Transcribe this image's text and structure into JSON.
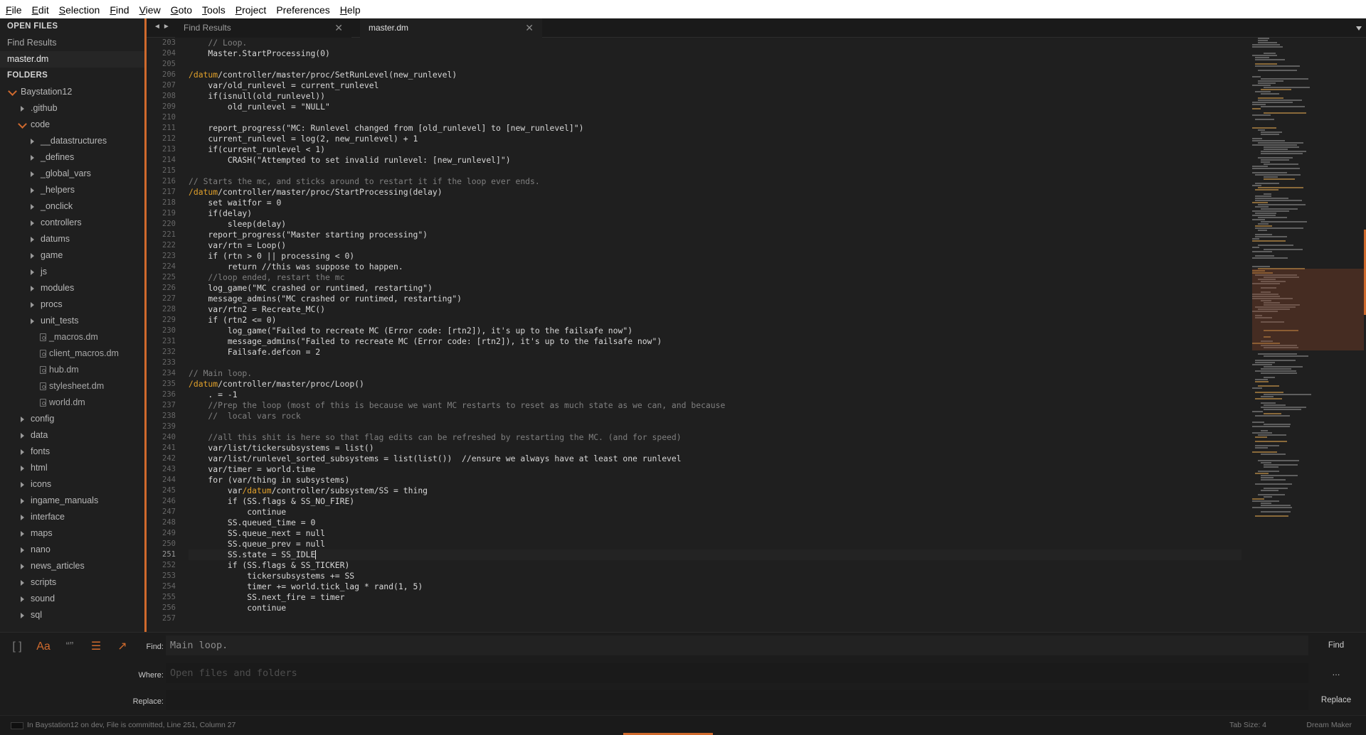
{
  "menu": [
    {
      "acc": "F",
      "rest": "ile"
    },
    {
      "acc": "E",
      "rest": "dit"
    },
    {
      "acc": "S",
      "rest": "election"
    },
    {
      "acc": "F",
      "rest": "ind"
    },
    {
      "acc": "V",
      "rest": "iew"
    },
    {
      "acc": "G",
      "rest": "oto"
    },
    {
      "acc": "T",
      "rest": "ools"
    },
    {
      "acc": "P",
      "rest": "roject"
    },
    {
      "acc": "",
      "rest": "Preferences"
    },
    {
      "acc": "H",
      "rest": "elp"
    }
  ],
  "sidebar": {
    "open_files_heading": "OPEN FILES",
    "open_files": [
      {
        "label": "Find Results",
        "active": false
      },
      {
        "label": "master.dm",
        "active": true
      }
    ],
    "folders_heading": "FOLDERS",
    "tree": [
      {
        "label": "Baystation12",
        "type": "folder",
        "open": true,
        "depth": 0
      },
      {
        "label": ".github",
        "type": "folder",
        "open": false,
        "depth": 1
      },
      {
        "label": "code",
        "type": "folder",
        "open": true,
        "depth": 1
      },
      {
        "label": "__datastructures",
        "type": "folder",
        "open": false,
        "depth": 2
      },
      {
        "label": "_defines",
        "type": "folder",
        "open": false,
        "depth": 2
      },
      {
        "label": "_global_vars",
        "type": "folder",
        "open": false,
        "depth": 2
      },
      {
        "label": "_helpers",
        "type": "folder",
        "open": false,
        "depth": 2
      },
      {
        "label": "_onclick",
        "type": "folder",
        "open": false,
        "depth": 2
      },
      {
        "label": "controllers",
        "type": "folder",
        "open": false,
        "depth": 2
      },
      {
        "label": "datums",
        "type": "folder",
        "open": false,
        "depth": 2
      },
      {
        "label": "game",
        "type": "folder",
        "open": false,
        "depth": 2
      },
      {
        "label": "js",
        "type": "folder",
        "open": false,
        "depth": 2
      },
      {
        "label": "modules",
        "type": "folder",
        "open": false,
        "depth": 2
      },
      {
        "label": "procs",
        "type": "folder",
        "open": false,
        "depth": 2
      },
      {
        "label": "unit_tests",
        "type": "folder",
        "open": false,
        "depth": 2
      },
      {
        "label": "_macros.dm",
        "type": "file",
        "depth": 2
      },
      {
        "label": "client_macros.dm",
        "type": "file",
        "depth": 2
      },
      {
        "label": "hub.dm",
        "type": "file",
        "depth": 2
      },
      {
        "label": "stylesheet.dm",
        "type": "file",
        "depth": 2
      },
      {
        "label": "world.dm",
        "type": "file",
        "depth": 2
      },
      {
        "label": "config",
        "type": "folder",
        "open": false,
        "depth": 1
      },
      {
        "label": "data",
        "type": "folder",
        "open": false,
        "depth": 1
      },
      {
        "label": "fonts",
        "type": "folder",
        "open": false,
        "depth": 1
      },
      {
        "label": "html",
        "type": "folder",
        "open": false,
        "depth": 1
      },
      {
        "label": "icons",
        "type": "folder",
        "open": false,
        "depth": 1
      },
      {
        "label": "ingame_manuals",
        "type": "folder",
        "open": false,
        "depth": 1
      },
      {
        "label": "interface",
        "type": "folder",
        "open": false,
        "depth": 1
      },
      {
        "label": "maps",
        "type": "folder",
        "open": false,
        "depth": 1
      },
      {
        "label": "nano",
        "type": "folder",
        "open": false,
        "depth": 1
      },
      {
        "label": "news_articles",
        "type": "folder",
        "open": false,
        "depth": 1
      },
      {
        "label": "scripts",
        "type": "folder",
        "open": false,
        "depth": 1
      },
      {
        "label": "sound",
        "type": "folder",
        "open": false,
        "depth": 1
      },
      {
        "label": "sql",
        "type": "folder",
        "open": false,
        "depth": 1
      }
    ]
  },
  "tabs": {
    "nav_arrows": "◄►",
    "find_results": "Find Results",
    "master": "master.dm",
    "close_glyph": "✕"
  },
  "editor": {
    "current_line": 251,
    "lines": [
      {
        "n": 203,
        "t": "    // Loop."
      },
      {
        "n": 204,
        "t": "    Master.StartProcessing(0)"
      },
      {
        "n": 205,
        "t": ""
      },
      {
        "n": 206,
        "t": "/datum/controller/master/proc/SetRunLevel(new_runlevel)"
      },
      {
        "n": 207,
        "t": "    var/old_runlevel = current_runlevel"
      },
      {
        "n": 208,
        "t": "    if(isnull(old_runlevel))"
      },
      {
        "n": 209,
        "t": "        old_runlevel = \"NULL\""
      },
      {
        "n": 210,
        "t": ""
      },
      {
        "n": 211,
        "t": "    report_progress(\"MC: Runlevel changed from [old_runlevel] to [new_runlevel]\")"
      },
      {
        "n": 212,
        "t": "    current_runlevel = log(2, new_runlevel) + 1"
      },
      {
        "n": 213,
        "t": "    if(current_runlevel < 1)"
      },
      {
        "n": 214,
        "t": "        CRASH(\"Attempted to set invalid runlevel: [new_runlevel]\")"
      },
      {
        "n": 215,
        "t": ""
      },
      {
        "n": 216,
        "t": "// Starts the mc, and sticks around to restart it if the loop ever ends."
      },
      {
        "n": 217,
        "t": "/datum/controller/master/proc/StartProcessing(delay)"
      },
      {
        "n": 218,
        "t": "    set waitfor = 0"
      },
      {
        "n": 219,
        "t": "    if(delay)"
      },
      {
        "n": 220,
        "t": "        sleep(delay)"
      },
      {
        "n": 221,
        "t": "    report_progress(\"Master starting processing\")"
      },
      {
        "n": 222,
        "t": "    var/rtn = Loop()"
      },
      {
        "n": 223,
        "t": "    if (rtn > 0 || processing < 0)"
      },
      {
        "n": 224,
        "t": "        return //this was suppose to happen."
      },
      {
        "n": 225,
        "t": "    //loop ended, restart the mc"
      },
      {
        "n": 226,
        "t": "    log_game(\"MC crashed or runtimed, restarting\")"
      },
      {
        "n": 227,
        "t": "    message_admins(\"MC crashed or runtimed, restarting\")"
      },
      {
        "n": 228,
        "t": "    var/rtn2 = Recreate_MC()"
      },
      {
        "n": 229,
        "t": "    if (rtn2 <= 0)"
      },
      {
        "n": 230,
        "t": "        log_game(\"Failed to recreate MC (Error code: [rtn2]), it's up to the failsafe now\")"
      },
      {
        "n": 231,
        "t": "        message_admins(\"Failed to recreate MC (Error code: [rtn2]), it's up to the failsafe now\")"
      },
      {
        "n": 232,
        "t": "        Failsafe.defcon = 2"
      },
      {
        "n": 233,
        "t": ""
      },
      {
        "n": 234,
        "t": "// Main loop."
      },
      {
        "n": 235,
        "t": "/datum/controller/master/proc/Loop()"
      },
      {
        "n": 236,
        "t": "    . = -1"
      },
      {
        "n": 237,
        "t": "    //Prep the loop (most of this is because we want MC restarts to reset as much state as we can, and because"
      },
      {
        "n": 238,
        "t": "    //  local vars rock"
      },
      {
        "n": 239,
        "t": ""
      },
      {
        "n": 240,
        "t": "    //all this shit is here so that flag edits can be refreshed by restarting the MC. (and for speed)"
      },
      {
        "n": 241,
        "t": "    var/list/tickersubsystems = list()"
      },
      {
        "n": 242,
        "t": "    var/list/runlevel_sorted_subsystems = list(list())  //ensure we always have at least one runlevel"
      },
      {
        "n": 243,
        "t": "    var/timer = world.time"
      },
      {
        "n": 244,
        "t": "    for (var/thing in subsystems)"
      },
      {
        "n": 245,
        "t": "        var/datum/controller/subsystem/SS = thing"
      },
      {
        "n": 246,
        "t": "        if (SS.flags & SS_NO_FIRE)"
      },
      {
        "n": 247,
        "t": "            continue"
      },
      {
        "n": 248,
        "t": "        SS.queued_time = 0"
      },
      {
        "n": 249,
        "t": "        SS.queue_next = null"
      },
      {
        "n": 250,
        "t": "        SS.queue_prev = null"
      },
      {
        "n": 251,
        "t": "        SS.state = SS_IDLE"
      },
      {
        "n": 252,
        "t": "        if (SS.flags & SS_TICKER)"
      },
      {
        "n": 253,
        "t": "            tickersubsystems += SS"
      },
      {
        "n": 254,
        "t": "            timer += world.tick_lag * rand(1, 5)"
      },
      {
        "n": 255,
        "t": "            SS.next_fire = timer"
      },
      {
        "n": 256,
        "t": "            continue"
      },
      {
        "n": 257,
        "t": ""
      }
    ]
  },
  "find_panel": {
    "toggles": [
      {
        "name": "regex-toggle",
        "glyph": "[ ]"
      },
      {
        "name": "case-toggle",
        "glyph": "Aa"
      },
      {
        "name": "whole-word-toggle",
        "glyph": "“”"
      },
      {
        "name": "show-context-toggle",
        "glyph": "☰"
      },
      {
        "name": "use-buffer-toggle",
        "glyph": "↗"
      }
    ],
    "find_label": "Find:",
    "find_value": "Main loop.",
    "where_label": "Where:",
    "where_placeholder": "Open files and folders",
    "where_button": "…",
    "replace_label": "Replace:",
    "replace_value": "",
    "find_button": "Find",
    "replace_button": "Replace"
  },
  "status": {
    "text": "In Baystation12 on dev, File is committed, Line 251, Column 27",
    "tab_size": "Tab Size: 4",
    "syntax": "Dream Maker"
  },
  "colors": {
    "accent": "#cf6a2d",
    "background": "#1f1f1f",
    "directive": "#e0a02b",
    "comment": "#7f7f7f"
  }
}
